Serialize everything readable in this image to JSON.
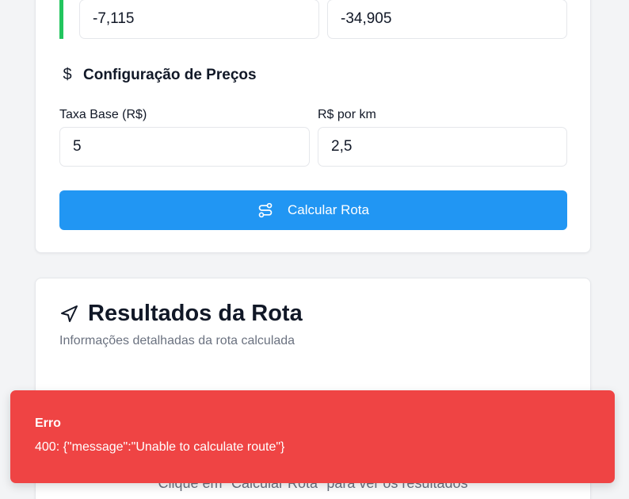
{
  "coordinates": {
    "latitude": "-7,115",
    "longitude": "-34,905"
  },
  "pricing": {
    "section_title": "Configuração de Preços",
    "section_icon": "dollar-icon",
    "base_fee_label": "Taxa Base (R$)",
    "base_fee_value": "5",
    "per_km_label": "R$ por km",
    "per_km_value": "2,5",
    "calculate_button": "Calcular Rota"
  },
  "results": {
    "title": "Resultados da Rota",
    "subtitle": "Informações detalhadas da rota calculada",
    "empty_text": "Clique em \"Calcular Rota\" para ver os resultados"
  },
  "toast": {
    "title": "Erro",
    "message": "400: {\"message\":\"Unable to calculate route\"}"
  },
  "colors": {
    "accent_green": "#22c55e",
    "primary_blue": "#2196f3",
    "error_red": "#ef4444"
  }
}
